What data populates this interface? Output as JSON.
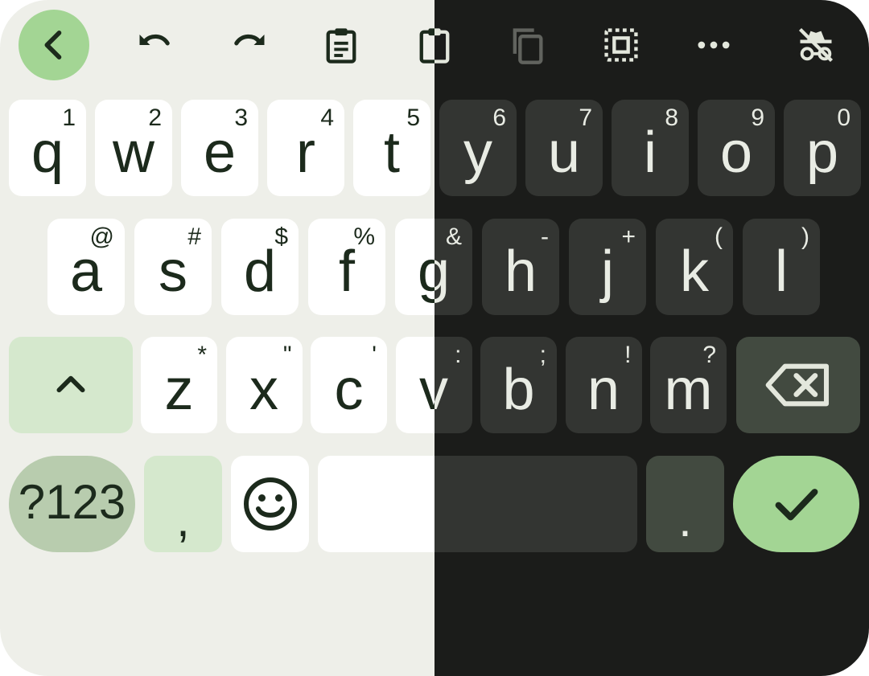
{
  "toolbar": {
    "back_icon": "chevron-left-icon",
    "undo_icon": "undo-icon",
    "redo_icon": "redo-icon",
    "clipboard_icon": "clipboard-icon",
    "paste_icon": "paste-icon",
    "copy_icon": "copy-icon",
    "select_all_icon": "select-all-icon",
    "more_icon": "more-icon",
    "incognito_icon": "incognito-off-icon"
  },
  "rows": {
    "row1": [
      {
        "key": "q",
        "hint": "1"
      },
      {
        "key": "w",
        "hint": "2"
      },
      {
        "key": "e",
        "hint": "3"
      },
      {
        "key": "r",
        "hint": "4"
      },
      {
        "key": "t",
        "hint": "5"
      },
      {
        "key": "y",
        "hint": "6"
      },
      {
        "key": "u",
        "hint": "7"
      },
      {
        "key": "i",
        "hint": "8"
      },
      {
        "key": "o",
        "hint": "9"
      },
      {
        "key": "p",
        "hint": "0"
      }
    ],
    "row2": [
      {
        "key": "a",
        "hint": "@"
      },
      {
        "key": "s",
        "hint": "#"
      },
      {
        "key": "d",
        "hint": "$"
      },
      {
        "key": "f",
        "hint": "%"
      },
      {
        "key": "g",
        "hint": "&"
      },
      {
        "key": "h",
        "hint": "-"
      },
      {
        "key": "j",
        "hint": "+"
      },
      {
        "key": "k",
        "hint": "("
      },
      {
        "key": "l",
        "hint": ")"
      }
    ],
    "row3": [
      {
        "key": "z",
        "hint": "*"
      },
      {
        "key": "x",
        "hint": "\""
      },
      {
        "key": "c",
        "hint": "'"
      },
      {
        "key": "v",
        "hint": ":"
      },
      {
        "key": "b",
        "hint": ";"
      },
      {
        "key": "n",
        "hint": "!"
      },
      {
        "key": "m",
        "hint": "?"
      }
    ]
  },
  "bottom": {
    "symbols_label": "?123",
    "comma_label": ",",
    "period_label": ".",
    "emoji_icon": "emoji-icon",
    "enter_icon": "checkmark-icon",
    "shift_icon": "shift-icon",
    "backspace_icon": "backspace-icon"
  },
  "colors": {
    "light_background": "#eeefe9",
    "dark_background": "#1b1c1a",
    "accent": "#a3d594"
  }
}
